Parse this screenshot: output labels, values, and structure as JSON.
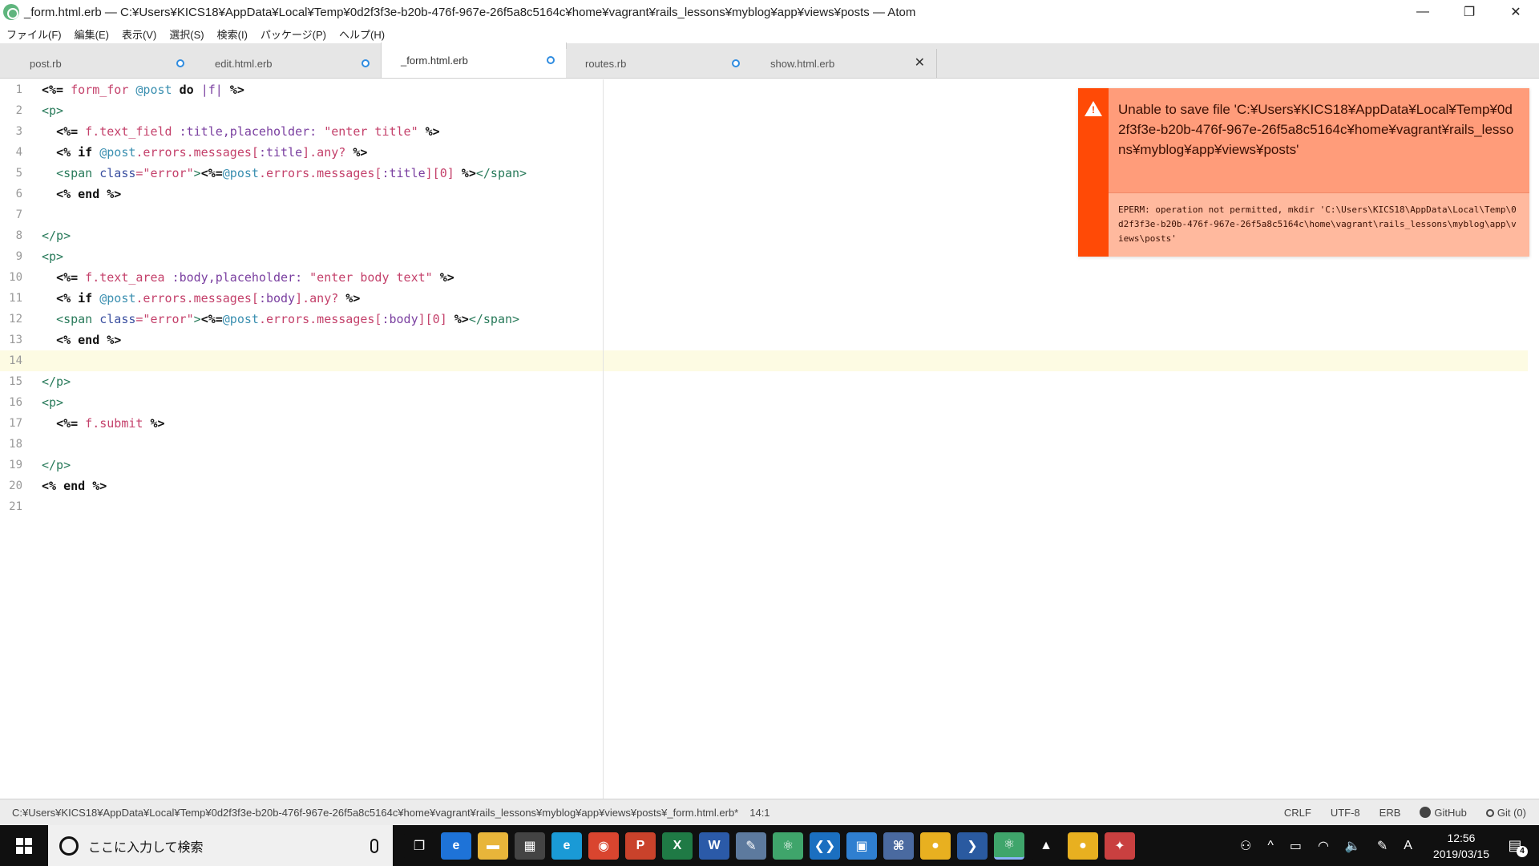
{
  "window": {
    "title": "_form.html.erb — C:¥Users¥KICS18¥AppData¥Local¥Temp¥0d2f3f3e-b20b-476f-967e-26f5a8c5164c¥home¥vagrant¥rails_lessons¥myblog¥app¥views¥posts — Atom",
    "minimize": "—",
    "restore": "❐",
    "close": "✕"
  },
  "menu": [
    "ファイル(F)",
    "編集(E)",
    "表示(V)",
    "選択(S)",
    "検索(I)",
    "パッケージ(P)",
    "ヘルプ(H)"
  ],
  "tabs": [
    {
      "label": "post.rb",
      "state": "modified"
    },
    {
      "label": "edit.html.erb",
      "state": "modified"
    },
    {
      "label": "_form.html.erb",
      "state": "modified",
      "active": true
    },
    {
      "label": "routes.rb",
      "state": "modified"
    },
    {
      "label": "show.html.erb",
      "state": "close"
    }
  ],
  "tab_close_glyph": "✕",
  "editor": {
    "line_numbers": [
      "1",
      "2",
      "3",
      "4",
      "5",
      "6",
      "7",
      "8",
      "9",
      "10",
      "11",
      "12",
      "13",
      "14",
      "15",
      "16",
      "17",
      "18",
      "19",
      "20",
      "21"
    ],
    "cursor_line": 14
  },
  "code": {
    "l1": {
      "a": "<%=",
      "b": " form_for ",
      "c": "@post",
      "d": " do ",
      "e": "|f|",
      "f": " %>"
    },
    "l2": {
      "a": "<p>"
    },
    "l3": {
      "a": "<%=",
      "b": " f.text_field ",
      "c": ":title,placeholder:",
      "d": " \"enter title\"",
      "e": " %>"
    },
    "l4": {
      "a": "<%",
      "b": " if ",
      "c": "@post",
      "d": ".errors.messages[",
      "e": ":title",
      "f": "].any?",
      "g": " %>"
    },
    "l5": {
      "a": "<span",
      "b": " class",
      "c": "=\"error\"",
      "d": ">",
      "e": "<%=",
      "f": "@post",
      "g": ".errors.messages[",
      "h": ":title",
      "i": "][0]",
      "j": " %>",
      "k": "</span>"
    },
    "l6": {
      "a": "<%",
      "b": " end ",
      "c": "%>"
    },
    "l8": {
      "a": "</p>"
    },
    "l9": {
      "a": "<p>"
    },
    "l10": {
      "a": "<%=",
      "b": " f.text_area ",
      "c": ":body,placeholder:",
      "d": " \"enter body text\"",
      "e": " %>"
    },
    "l11": {
      "a": "<%",
      "b": " if ",
      "c": "@post",
      "d": ".errors.messages[",
      "e": ":body",
      "f": "].any?",
      "g": " %>"
    },
    "l12": {
      "a": "<span",
      "b": " class",
      "c": "=\"error\"",
      "d": ">",
      "e": "<%=",
      "f": "@post",
      "g": ".errors.messages[",
      "h": ":body",
      "i": "][0]",
      "j": " %>",
      "k": "</span>"
    },
    "l13": {
      "a": "<%",
      "b": " end ",
      "c": "%>"
    },
    "l15": {
      "a": "</p>"
    },
    "l16": {
      "a": "<p>"
    },
    "l17": {
      "a": "<%=",
      "b": " f.submit ",
      "c": "%>"
    },
    "l19": {
      "a": "</p>"
    },
    "l20": {
      "a": "<%",
      "b": " end ",
      "c": "%>"
    }
  },
  "notification": {
    "icon": "⚠",
    "icon_glyph": "!",
    "message": "Unable to save file 'C:¥Users¥KICS18¥AppData¥Local¥Temp¥0d2f3f3e-b20b-476f-967e-26f5a8c5164c¥home¥vagrant¥rails_lessons¥myblog¥app¥views¥posts'",
    "detail": "EPERM: operation not permitted, mkdir 'C:\\Users\\KICS18\\AppData\\Local\\Temp\\0d2f3f3e-b20b-476f-967e-26f5a8c5164c\\home\\vagrant\\rails_lessons\\myblog\\app\\views\\posts'",
    "color": "#ff4a06"
  },
  "status": {
    "path": "C:¥Users¥KICS18¥AppData¥Local¥Temp¥0d2f3f3e-b20b-476f-967e-26f5a8c5164c¥home¥vagrant¥rails_lessons¥myblog¥app¥views¥posts¥_form.html.erb*",
    "position": "14:1",
    "line_ending": "CRLF",
    "encoding": "UTF-8",
    "grammar": "ERB",
    "github": "GitHub",
    "git": "Git (0)"
  },
  "taskbar": {
    "search_placeholder": "ここに入力して検索",
    "apps": [
      {
        "name": "task-view-icon",
        "glyph": "❐",
        "color": "#101010"
      },
      {
        "name": "edge-icon",
        "glyph": "e",
        "color": "#1e73d8"
      },
      {
        "name": "file-explorer-icon",
        "glyph": "▬",
        "color": "#e8b53a"
      },
      {
        "name": "store-icon",
        "glyph": "▦",
        "color": "#444"
      },
      {
        "name": "ie-icon",
        "glyph": "e",
        "color": "#1a9ad6"
      },
      {
        "name": "chrome-icon",
        "glyph": "◉",
        "color": "#d9452f"
      },
      {
        "name": "powerpoint-icon",
        "glyph": "P",
        "color": "#c9422b"
      },
      {
        "name": "excel-icon",
        "glyph": "X",
        "color": "#1f7a45"
      },
      {
        "name": "word-icon",
        "glyph": "W",
        "color": "#2b5aa8"
      },
      {
        "name": "notepad-icon",
        "glyph": "✎",
        "color": "#5d7a9e"
      },
      {
        "name": "atom-app-icon",
        "glyph": "⚛",
        "color": "#3fa56b"
      },
      {
        "name": "vscode-icon",
        "glyph": "❮❯",
        "color": "#1b6fc0"
      },
      {
        "name": "app-box-icon",
        "glyph": "▣",
        "color": "#2f7fd0"
      },
      {
        "name": "network-icon",
        "glyph": "⌘",
        "color": "#4a6aa0"
      },
      {
        "name": "duck-icon",
        "glyph": "●",
        "color": "#e8b020"
      },
      {
        "name": "powershell-icon",
        "glyph": "❯",
        "color": "#2a5aa0"
      },
      {
        "name": "atom-active-icon",
        "glyph": "⚛",
        "color": "#3fa56b"
      },
      {
        "name": "photos-icon",
        "glyph": "▲",
        "color": "#101010"
      },
      {
        "name": "duck2-icon",
        "glyph": "●",
        "color": "#e8b020"
      },
      {
        "name": "bird-icon",
        "glyph": "✦",
        "color": "#c94040"
      }
    ],
    "tray": {
      "people": "⚇",
      "chevron": "^",
      "battery": "▭",
      "wifi": "◠",
      "volume": "🔈",
      "pen": "✎",
      "ime": "A",
      "time": "12:56",
      "date": "2019/03/15",
      "notifications": "▤",
      "notification_count": "4"
    }
  }
}
